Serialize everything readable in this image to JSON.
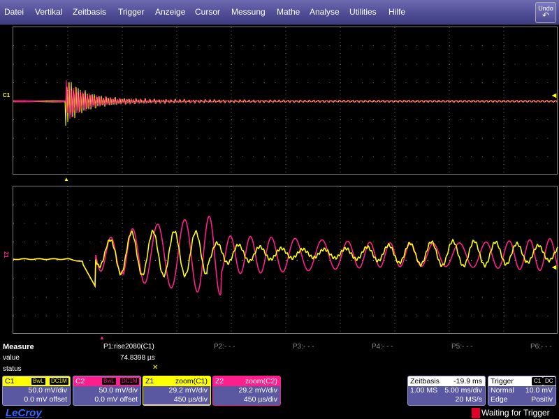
{
  "menu": [
    "Datei",
    "Vertikal",
    "Zeitbasis",
    "Trigger",
    "Anzeige",
    "Cursor",
    "Messung",
    "Mathe",
    "Analyse",
    "Utilities",
    "Hilfe"
  ],
  "undo": "Undo",
  "ch1_marker": "C1",
  "ch2_marker": "Z1",
  "measure": {
    "title": "Measure",
    "value_label": "value",
    "status_label": "status",
    "p1": "P1:rise2080(C1)",
    "p1_value": "74.8398 µs",
    "p1_status": "✕",
    "p2": "P2:- - -",
    "p3": "P3:- - -",
    "p4": "P4:- - -",
    "p5": "P5:- - -",
    "p6": "P6:- - -"
  },
  "channels": {
    "c1": {
      "name": "C1",
      "bw": "BwL",
      "cpl": "DC1M",
      "line1": "50.0 mV/div",
      "line2": "0.0 mV offset",
      "color": "#ffff00"
    },
    "c2": {
      "name": "C2",
      "bw": "BwL",
      "cpl": "DC1M",
      "line1": "50.0 mV/div",
      "line2": "0.0 mV offset",
      "color": "#ff1e8c"
    },
    "z1": {
      "name": "Z1",
      "src": "zoom(C1)",
      "line1": "29.2 mV/div",
      "line2": "450 µs/div"
    },
    "z2": {
      "name": "Z2",
      "src": "zoom(C2)",
      "line1": "29.2 mV/div",
      "line2": "450 µs/div"
    }
  },
  "timebase": {
    "title": "Zeitbasis",
    "delay": "-19.9 ms",
    "samples": "1.00 MS",
    "tdiv": "5.00 ms/div",
    "srate": "20 MS/s"
  },
  "trigger": {
    "title": "Trigger",
    "src": "C1",
    "cpl": "DC",
    "mode": "Normal",
    "level": "10.0 mV",
    "type": "Edge",
    "slope": "Positiv"
  },
  "logo": "LeCroy",
  "status": "Waiting for Trigger",
  "colors": {
    "c1": "#ffff00",
    "c2": "#ff1e8c",
    "z1": "#e8c8ff",
    "z2": "#ffc0e0",
    "menu": "#5a58a0"
  }
}
